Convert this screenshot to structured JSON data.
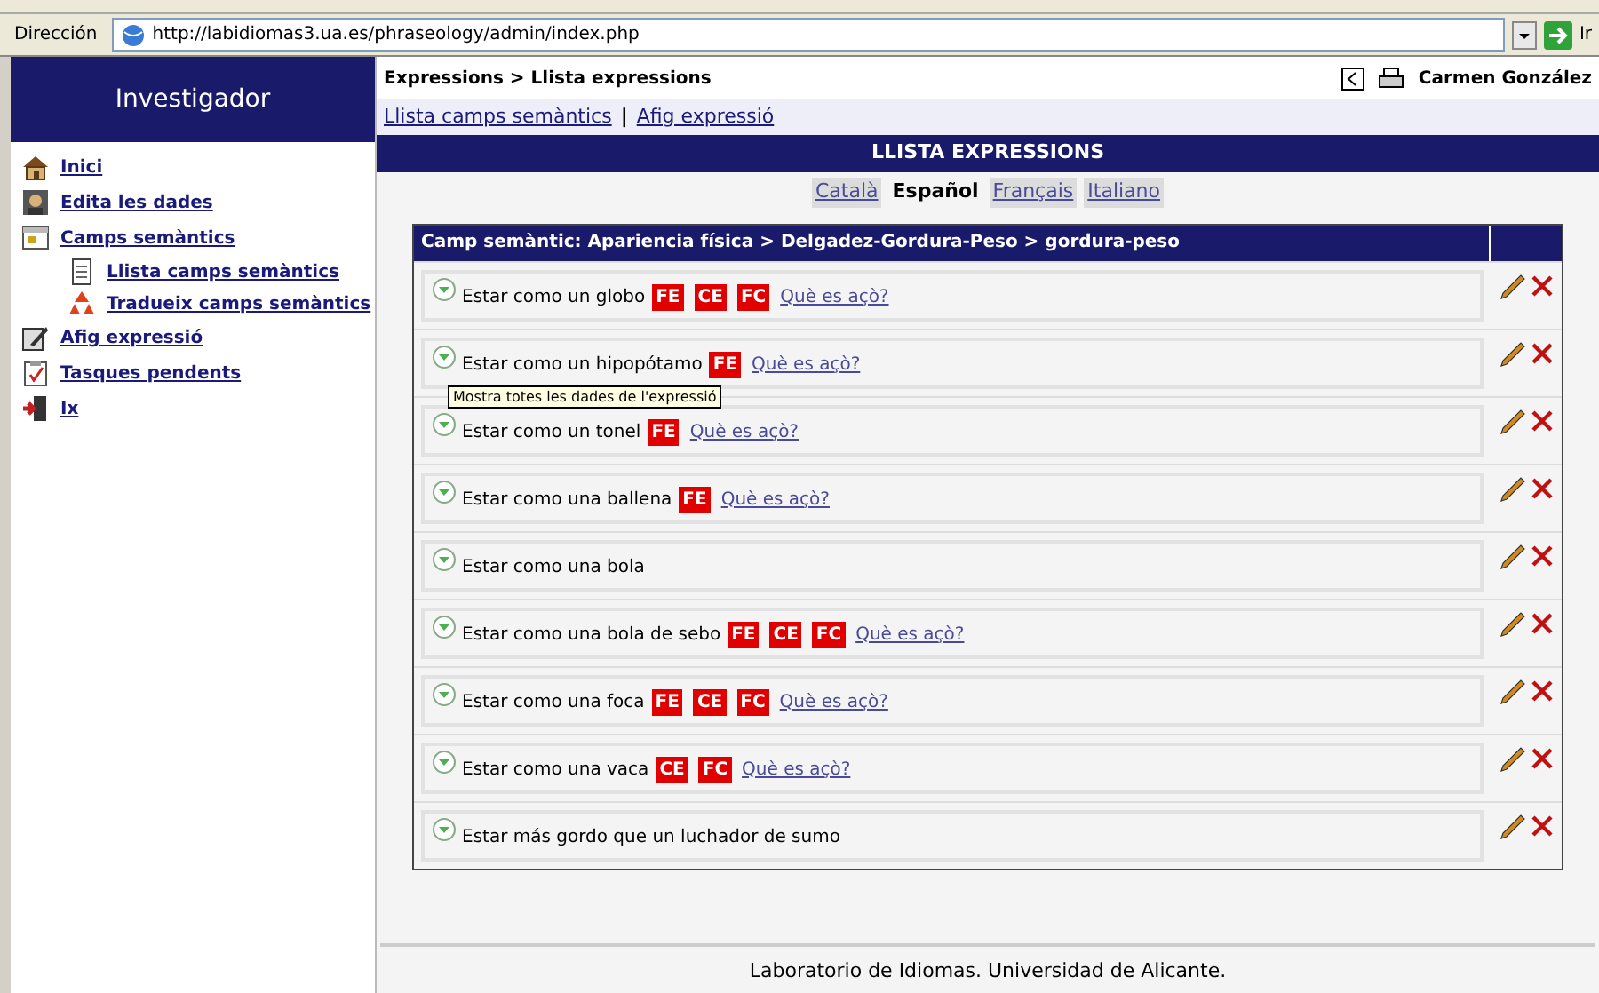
{
  "address_bar": {
    "label": "Dirección",
    "url": "http://labidiomas3.ua.es/phraseology/admin/index.php",
    "go": "Ir"
  },
  "sidebar": {
    "title": "Investigador",
    "items": [
      {
        "label": "Inici",
        "kind": "home"
      },
      {
        "label": "Edita les dades",
        "kind": "user"
      },
      {
        "label": "Camps semàntics",
        "kind": "folder",
        "children": [
          {
            "label": "Llista camps semàntics",
            "kind": "list"
          },
          {
            "label": "Tradueix camps semàntics",
            "kind": "recycle"
          }
        ]
      },
      {
        "label": "Afig expressió",
        "kind": "edit"
      },
      {
        "label": "Tasques pendents",
        "kind": "clipboard"
      },
      {
        "label": "Ix",
        "kind": "exit"
      }
    ]
  },
  "header": {
    "breadcrumb": "Expressions > Llista expressions",
    "user": "Carmen González",
    "links": [
      "Llista camps semàntics",
      "Afig expressió"
    ],
    "separator": "|"
  },
  "title": "LLISTA EXPRESSIONS",
  "languages": [
    {
      "label": "Català",
      "selected": false
    },
    {
      "label": "Español",
      "selected": true
    },
    {
      "label": "Français",
      "selected": false
    },
    {
      "label": "Italiano",
      "selected": false
    }
  ],
  "table": {
    "heading": "Camp semàntic: Apariencia física > Delgadez-Gordura-Peso > gordura-peso",
    "rows": [
      {
        "text": "Estar como un globo",
        "tags": [
          "FE",
          "CE",
          "FC"
        ],
        "link": "Què es açò?"
      },
      {
        "text": "Estar como un hipopótamo",
        "tags": [
          "FE"
        ],
        "link": "Què es açò?"
      },
      {
        "text": "Estar como un tonel",
        "tags": [
          "FE"
        ],
        "link": "Què es açò?"
      },
      {
        "text": "Estar como una ballena",
        "tags": [
          "FE"
        ],
        "link": "Què es açò?"
      },
      {
        "text": "Estar como una bola",
        "tags": []
      },
      {
        "text": "Estar como una bola de sebo",
        "tags": [
          "FE",
          "CE",
          "FC"
        ],
        "link": "Què es açò?"
      },
      {
        "text": "Estar como una foca",
        "tags": [
          "FE",
          "CE",
          "FC"
        ],
        "link": "Què es açò?"
      },
      {
        "text": "Estar como una vaca",
        "tags": [
          "CE",
          "FC"
        ],
        "link": "Què es açò?"
      },
      {
        "text": "Estar más gordo que un luchador de sumo",
        "tags": []
      }
    ]
  },
  "tooltip": "Mostra totes les dades de l'expressió",
  "footer": "Laboratorio de Idiomas. Universidad de Alicante."
}
